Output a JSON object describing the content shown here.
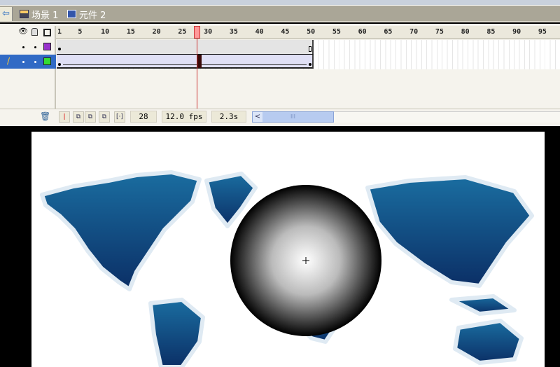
{
  "breadcrumb": {
    "back_icon": "arrow-left-icon",
    "items": [
      {
        "label": "场景 1",
        "icon": "scene-clapper-icon"
      },
      {
        "label": "元件 2",
        "icon": "symbol-icon"
      }
    ]
  },
  "timeline": {
    "ruler_labels": [
      "1",
      "5",
      "10",
      "15",
      "20",
      "25",
      "30",
      "35",
      "40",
      "45",
      "50",
      "55",
      "60",
      "65",
      "70",
      "75",
      "80",
      "85",
      "90",
      "95"
    ],
    "current_frame": 28,
    "total_frames": 50,
    "layers": [
      {
        "color": "#9933cc",
        "selected": false
      },
      {
        "color": "#33dd33",
        "selected": true
      }
    ],
    "status": {
      "frame": "28",
      "fps": "12.0 fps",
      "time": "2.3s"
    },
    "scrollbar_grip": "III"
  },
  "colors": {
    "accent": "#316ac5",
    "playhead": "#ff9999",
    "map": "#0e4a80"
  }
}
